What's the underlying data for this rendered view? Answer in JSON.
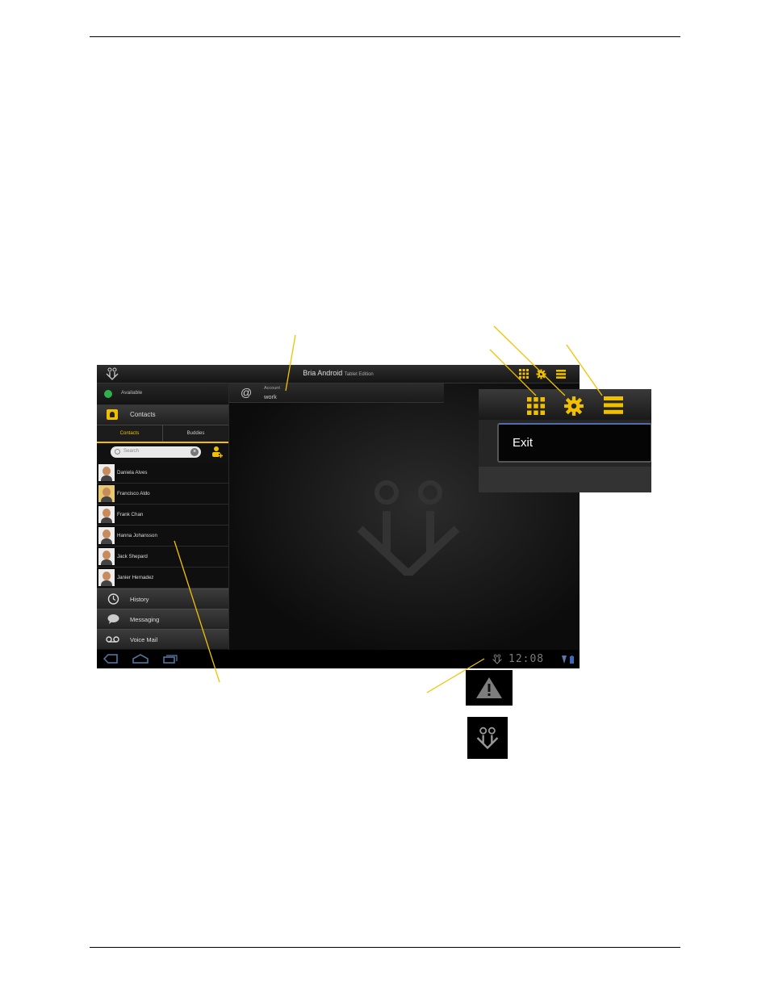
{
  "app": {
    "title": "Bria Android",
    "title_suffix": "Tablet Edition",
    "accent_color": "#f0c000"
  },
  "status": {
    "label": "Available",
    "icon": "check-icon"
  },
  "contacts_header": {
    "label": "Contacts",
    "icon": "contact-book-icon"
  },
  "tabs": [
    {
      "label": "Contacts",
      "active": true
    },
    {
      "label": "Buddies",
      "active": false
    }
  ],
  "search": {
    "placeholder": "Search"
  },
  "contacts": [
    "Daniela Alves",
    "Francisco Aldo",
    "Frank Chan",
    "Hanna Johansson",
    "Jack Shepard",
    "Janier Hernadez"
  ],
  "nav": [
    {
      "label": "History",
      "icon": "clock-icon"
    },
    {
      "label": "Messaging",
      "icon": "speech-bubble-icon"
    },
    {
      "label": "Voice Mail",
      "icon": "voicemail-icon"
    }
  ],
  "account": {
    "key": "Account",
    "value": "work",
    "symbol": "@"
  },
  "system_bar": {
    "time": "12:08"
  },
  "popup_menu": {
    "item": "Exit"
  },
  "icons": [
    "dialpad-icon",
    "gear-icon",
    "menu-icon",
    "warning-icon",
    "bria-logo-icon"
  ]
}
